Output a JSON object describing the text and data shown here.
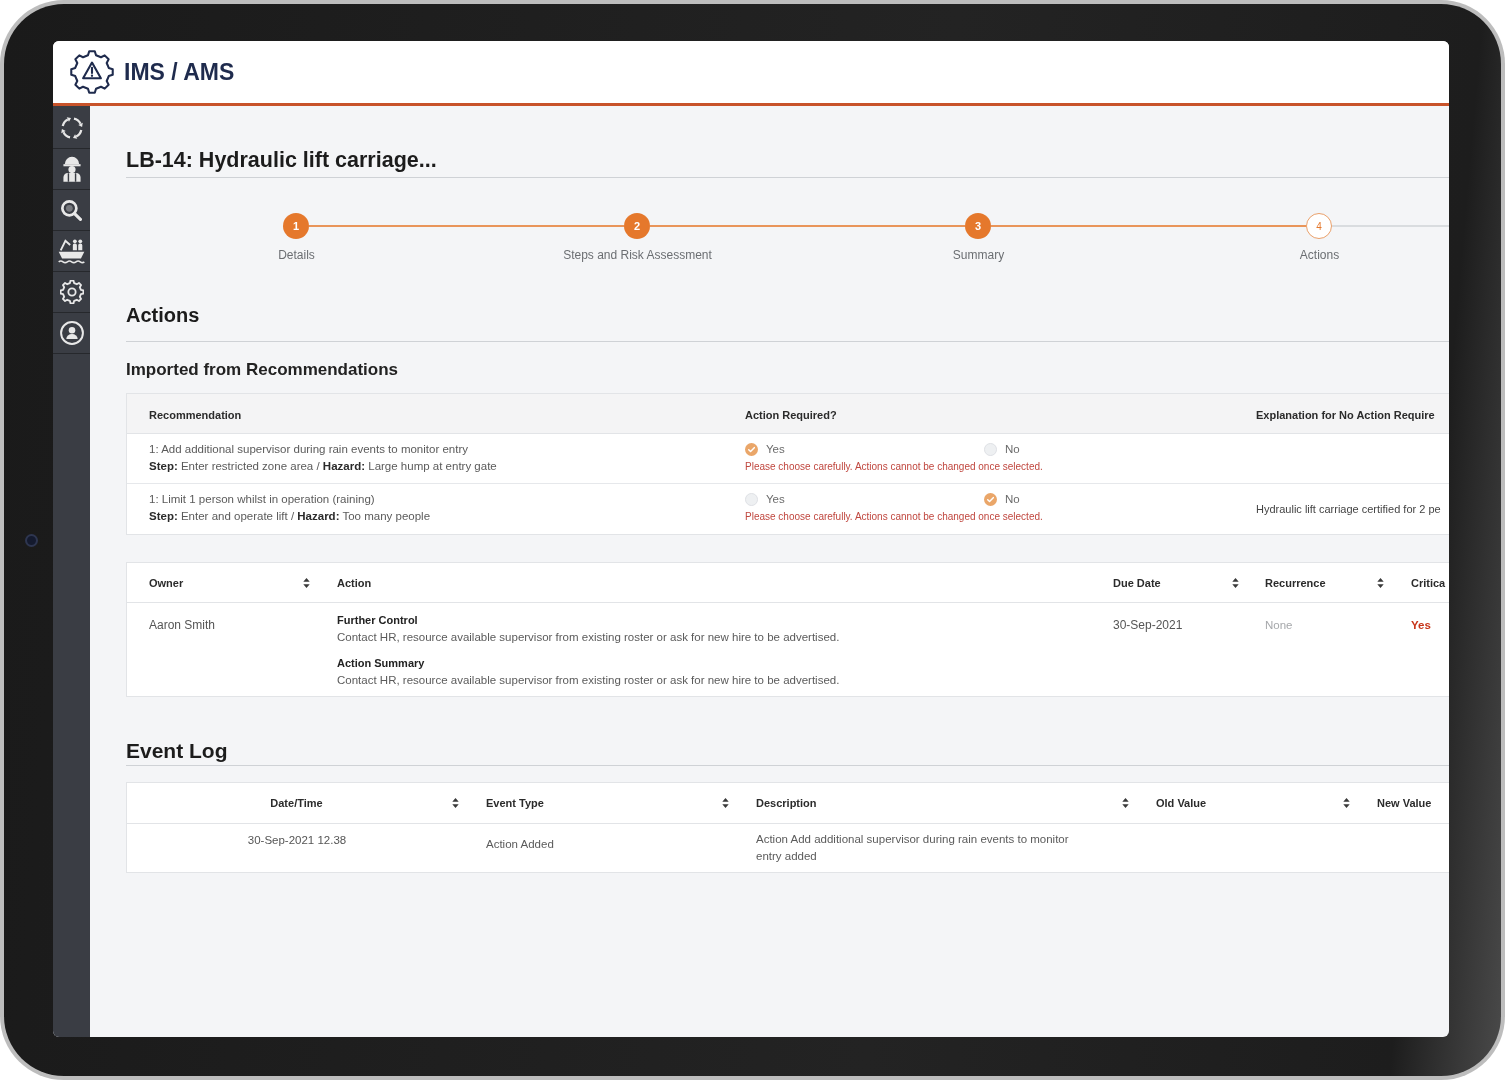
{
  "header": {
    "logo_text": "IMS / AMS"
  },
  "page": {
    "title": "LB-14: Hydraulic lift carriage..."
  },
  "stepper": {
    "steps": [
      {
        "number": "1",
        "label": "Details",
        "completed": true
      },
      {
        "number": "2",
        "label": "Steps and Risk Assessment",
        "completed": true
      },
      {
        "number": "3",
        "label": "Summary",
        "completed": true
      },
      {
        "number": "4",
        "label": "Actions",
        "completed": false
      }
    ]
  },
  "actions": {
    "heading": "Actions",
    "subheading": "Imported from Recommendations",
    "recommendations_table": {
      "columns": [
        "Recommendation",
        "Action Required?",
        "Explanation for No Action Require"
      ],
      "rows": [
        {
          "recommendation": "1: Add additional supervisor during rain events to monitor entry",
          "detail": "**Step:** Enter restricted zone area / **Hazard:** Large hump at entry gate",
          "options": [
            {
              "label": "Yes",
              "selected": true
            },
            {
              "label": "No",
              "selected": false
            }
          ],
          "warning": "Please choose carefully. Actions cannot be changed once selected."
        },
        {
          "recommendation": "1: Limit 1 person whilst in operation (raining)",
          "detail": "**Step:** Enter and operate lift / **Hazard:** Too many people",
          "options": [
            {
              "label": "Yes",
              "selected": false
            },
            {
              "label": "No",
              "selected": true
            }
          ],
          "warning": "Please choose carefully. Actions cannot be changed once selected.",
          "column_3": "Hydraulic lift carriage certified for 2 pe"
        }
      ]
    },
    "actions_table": {
      "columns": [
        {
          "label": "Owner",
          "sortable": true
        },
        {
          "label": "Action"
        },
        {
          "label": "Due Date",
          "sortable": true
        },
        {
          "label": "Recurrence",
          "sortable": true
        },
        {
          "label": "Critica"
        }
      ],
      "rows": [
        {
          "owner": "Aaron Smith",
          "action": [
            {
              "title": "Further Control",
              "text": "Contact HR, resource available supervisor from existing roster or ask for new hire to be advertised."
            },
            {
              "title": "Action Summary",
              "text": "Contact HR, resource available supervisor from existing roster or ask for new hire to be advertised."
            }
          ],
          "due_date": "30-Sep-2021",
          "recurrence": "None",
          "column_5": "Yes"
        }
      ]
    }
  },
  "event_log": {
    "heading": "Event Log",
    "columns": [
      {
        "label": "Date/Time",
        "sortable": true
      },
      {
        "label": "Event Type",
        "sortable": true
      },
      {
        "label": "Description",
        "sortable": true
      },
      {
        "label": "Old Value",
        "sortable": true
      },
      {
        "label": "New Value"
      }
    ],
    "rows": [
      {
        "date_time": "30-Sep-2021 12.38",
        "event_type": "Action Added",
        "description": "Action Add additional supervisor during rain events to monitor entry added"
      }
    ]
  }
}
